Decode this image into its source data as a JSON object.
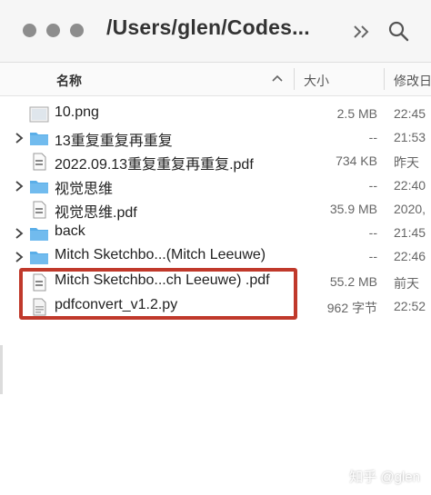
{
  "toolbar": {
    "path_title": "/Users/glen/Codes..."
  },
  "columns": {
    "name": "名称",
    "size": "大小",
    "date": "修改日"
  },
  "rows": [
    {
      "name": "10.png",
      "size": "2.5 MB",
      "date": "22:45",
      "type": "image",
      "expandable": false
    },
    {
      "name": "13重复重复再重复",
      "size": "--",
      "date": "21:53",
      "type": "folder",
      "expandable": true
    },
    {
      "name": "2022.09.13重复重复再重复.pdf",
      "size": "734 KB",
      "date": "昨天",
      "type": "pdf",
      "expandable": false
    },
    {
      "name": "视觉思维",
      "size": "--",
      "date": "22:40",
      "type": "folder",
      "expandable": true
    },
    {
      "name": "视觉思维.pdf",
      "size": "35.9 MB",
      "date": "2020,",
      "type": "pdf",
      "expandable": false
    },
    {
      "name": "back",
      "size": "--",
      "date": "21:45",
      "type": "folder",
      "expandable": true
    },
    {
      "name": "Mitch Sketchbo...(Mitch Leeuwe)",
      "size": "--",
      "date": "22:46",
      "type": "folder",
      "expandable": true
    },
    {
      "name": "Mitch Sketchbo...ch Leeuwe) .pdf",
      "size": "55.2 MB",
      "date": "前天",
      "type": "pdf",
      "expandable": false
    },
    {
      "name": "pdfconvert_v1.2.py",
      "size": "962 字节",
      "date": "22:52",
      "type": "script",
      "expandable": false
    }
  ],
  "watermark": "知乎 @glen",
  "colors": {
    "folder": "#5aaee8",
    "highlight": "#c0392b"
  }
}
